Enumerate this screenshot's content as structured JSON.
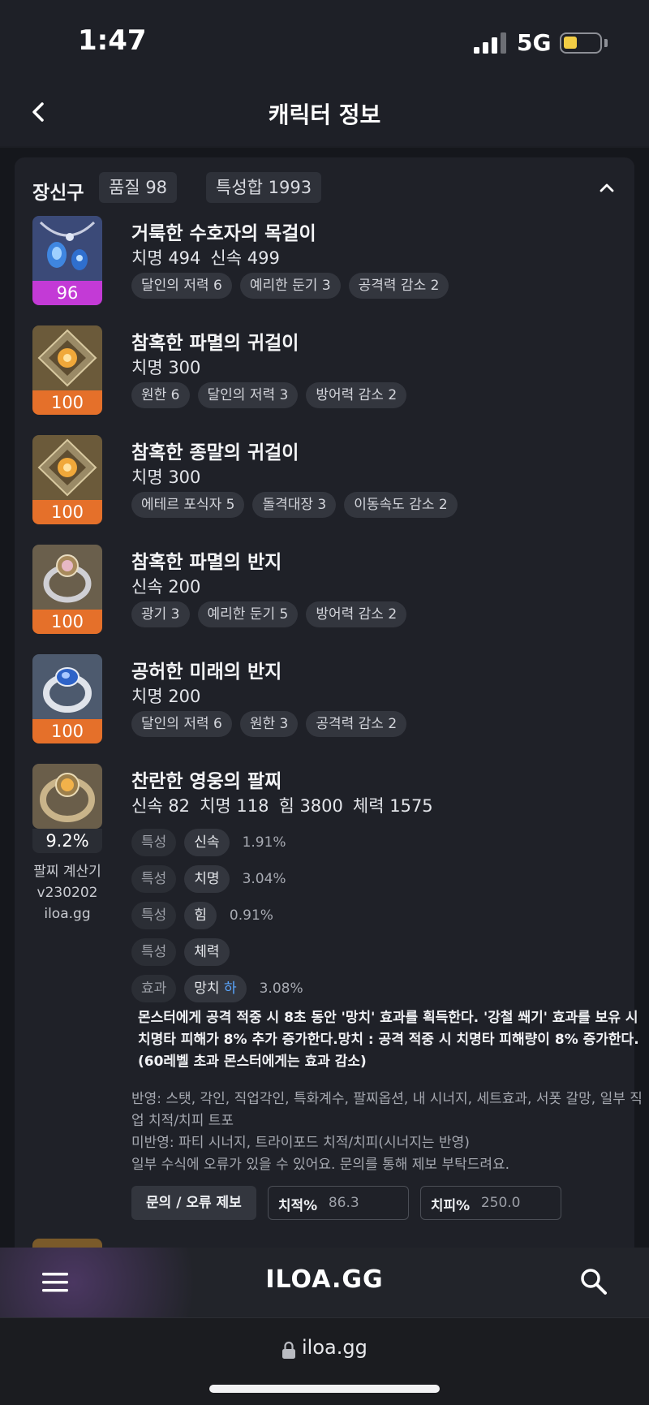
{
  "status_bar": {
    "time": "1:47",
    "network": "5G"
  },
  "header": {
    "title": "캐릭터 정보"
  },
  "section": {
    "title": "장신구",
    "quality_label": "품질 98",
    "stats_label": "특성합 1993"
  },
  "items": [
    {
      "name": "거룩한 수호자의 목걸이",
      "level": "96",
      "stats": [
        "치명 494",
        "신속 499"
      ],
      "engravings": [
        "달인의 저력 6",
        "예리한 둔기 3",
        "공격력 감소 2"
      ]
    },
    {
      "name": "참혹한 파멸의 귀걸이",
      "level": "100",
      "stats": [
        "치명 300"
      ],
      "engravings": [
        "원한 6",
        "달인의 저력 3",
        "방어력 감소 2"
      ]
    },
    {
      "name": "참혹한 종말의 귀걸이",
      "level": "100",
      "stats": [
        "치명 300"
      ],
      "engravings": [
        "에테르 포식자 5",
        "돌격대장 3",
        "이동속도 감소 2"
      ]
    },
    {
      "name": "참혹한 파멸의 반지",
      "level": "100",
      "stats": [
        "신속 200"
      ],
      "engravings": [
        "광기 3",
        "예리한 둔기 5",
        "방어력 감소 2"
      ]
    },
    {
      "name": "공허한 미래의 반지",
      "level": "100",
      "stats": [
        "치명 200"
      ],
      "engravings": [
        "달인의 저력 6",
        "원한 3",
        "공격력 감소 2"
      ]
    }
  ],
  "bracelet": {
    "name": "찬란한 영웅의 팔찌",
    "percent": "9.2%",
    "calc_line1": "팔찌 계산기",
    "calc_line2": "v230202",
    "calc_line3": "iloa.gg",
    "stats": [
      "신속 82",
      "치명 118",
      "힘 3800",
      "체력 1575"
    ],
    "rows": [
      {
        "kind": "특성",
        "value": "신속",
        "pct": "1.91%"
      },
      {
        "kind": "특성",
        "value": "치명",
        "pct": "3.04%"
      },
      {
        "kind": "특성",
        "value": "힘",
        "pct": "0.91%"
      },
      {
        "kind": "특성",
        "value": "체력",
        "pct": ""
      }
    ],
    "effect": {
      "kind": "효과",
      "value": "망치",
      "grade": "하",
      "pct": "3.08%"
    },
    "description": "몬스터에게 공격 적중 시 8초 동안 '망치' 효과를 획득한다. '강철 쐐기' 효과를 보유 시 치명타 피해가 8% 추가 증가한다.망치 : 공격 적중 시 치명타 피해량이 8% 증가한다. (60레벨 초과 몬스터에게는 효과 감소)",
    "note1": "반영: 스탯, 각인, 직업각인, 특화계수, 팔찌옵션, 내 시너지, 세트효과, 서폿 갈망, 일부 직업 치적/치피 트포",
    "note2": "미반영: 파티 시너지, 트라이포드 치적/치피(시너지는 반영)",
    "note3": "일부 수식에 오류가 있을 수 있어요. 문의를 통해 제보 부탁드려요.",
    "report_button": "문의 / 오류 제보",
    "crit_rate_label": "치적%",
    "crit_rate_value": "86.3",
    "crit_dmg_label": "치피%",
    "crit_dmg_value": "250.0"
  },
  "bottom_nav": {
    "brand": "ILOA.GG"
  },
  "browser": {
    "url": "iloa.gg"
  },
  "icons": [
    "chevron-left-icon",
    "chevron-up-icon",
    "menu-icon",
    "search-icon",
    "lock-icon"
  ],
  "colors": {
    "level_orange": "#e5702a",
    "level_purple": "#c33ad6",
    "grade_blue": "#5aa6ff"
  }
}
